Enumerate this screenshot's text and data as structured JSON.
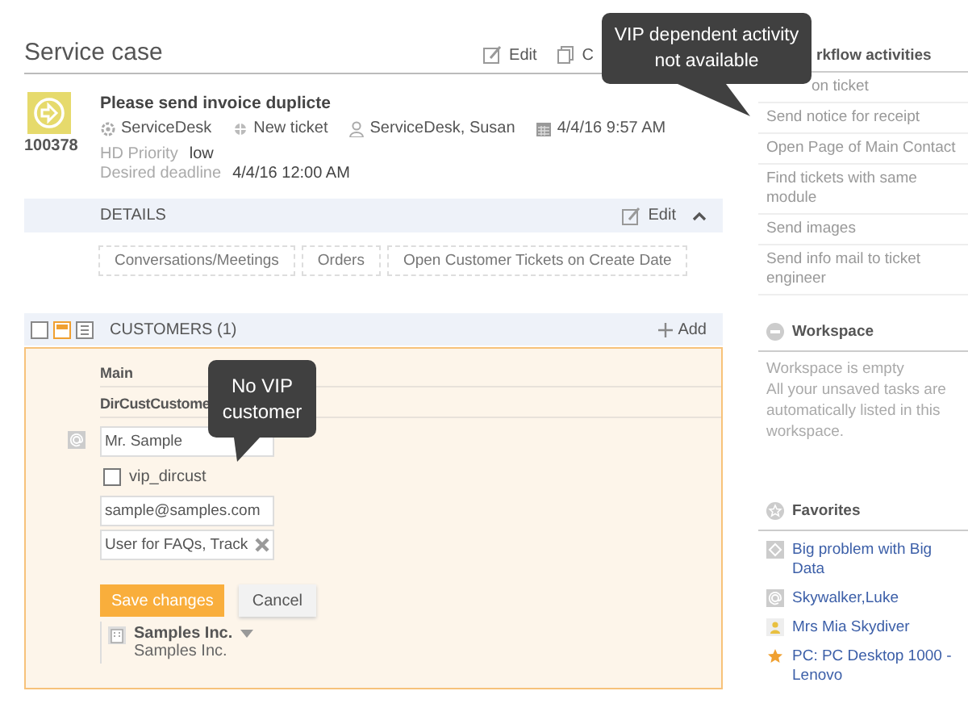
{
  "header": {
    "title": "Service case",
    "actions": [
      {
        "kind": "edit",
        "label": "Edit"
      },
      {
        "kind": "copy",
        "label": "C"
      }
    ]
  },
  "case": {
    "number": "100378",
    "title": "Please send invoice duplicte",
    "meta": [
      {
        "kind": "gear",
        "text": "ServiceDesk"
      },
      {
        "kind": "target",
        "text": "New ticket"
      },
      {
        "kind": "person",
        "text": "ServiceDesk, Susan"
      },
      {
        "kind": "calendar",
        "text": "4/4/16 9:57 AM"
      }
    ],
    "fields": [
      {
        "label": "HD Priority",
        "value": "low"
      },
      {
        "label": "Desired deadline",
        "value": "4/4/16 12:00 AM"
      }
    ]
  },
  "details": {
    "title": "DETAILS",
    "edit": "Edit",
    "expanded": true,
    "tabs": [
      "Conversations/Meetings",
      "Orders",
      "Open Customer Tickets on Create Date"
    ]
  },
  "customers": {
    "title": "CUSTOMERS (1)",
    "add": "Add",
    "views": [
      {
        "selected": false
      },
      {
        "selected": true
      },
      {
        "selected": false
      }
    ],
    "record": {
      "group": "Main",
      "subgroup": "DirCustCustome",
      "name": "Mr. Sample",
      "vip": {
        "label": "vip_dircust",
        "checked": false
      },
      "email": "sample@samples.com",
      "tags": "User for FAQs, Track",
      "save": "Save changes",
      "cancel": "Cancel",
      "company": {
        "name": "Samples Inc.",
        "sub": "Samples Inc."
      }
    }
  },
  "sidebar": {
    "workflow": {
      "title": "rkflow activities",
      "items": [
        "on ticket",
        "Send notice for receipt",
        "Open Page of Main Contact",
        "Find tickets with same module",
        "Send images",
        "Send info mail to ticket engineer"
      ]
    },
    "workspace": {
      "title": "Workspace",
      "lines": [
        "Workspace is empty",
        "All your unsaved tasks are automatically listed in this workspace."
      ]
    },
    "favorites": {
      "title": "Favorites",
      "items": [
        {
          "kind": "case",
          "label": "Big problem with Big Data"
        },
        {
          "kind": "contact",
          "label": "Skywalker,Luke"
        },
        {
          "kind": "person",
          "label": "Mrs Mia Skydiver"
        },
        {
          "kind": "star",
          "label": "PC: PC Desktop 1000 - Lenovo"
        }
      ]
    }
  },
  "tooltips": [
    {
      "kind": "activity",
      "text": "VIP dependent activity not available"
    },
    {
      "kind": "customer",
      "text": "No VIP customer"
    }
  ]
}
